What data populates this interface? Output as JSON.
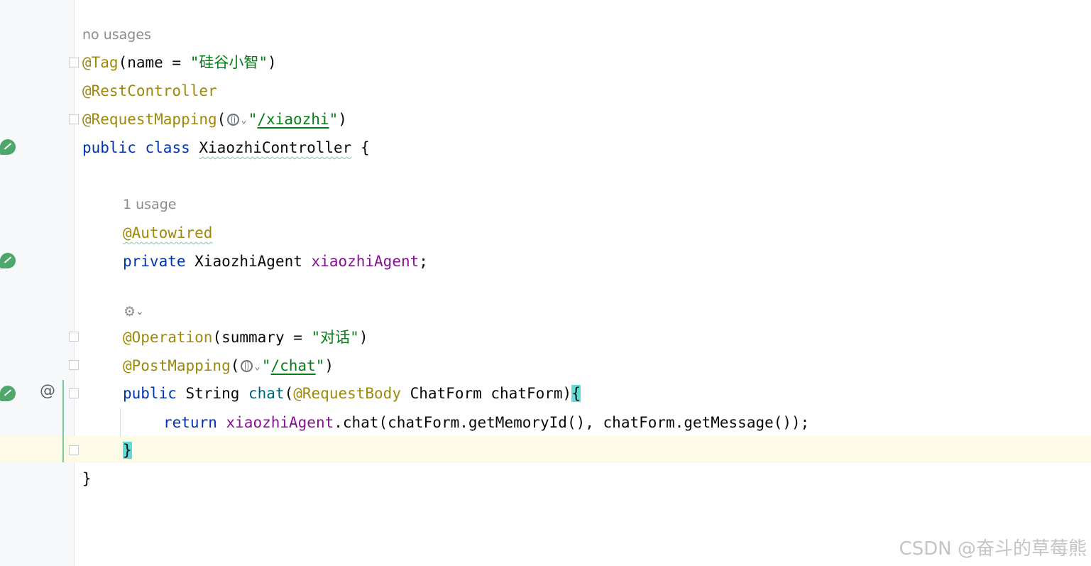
{
  "hints": {
    "class_usages": "no usages",
    "field_usages": "1 usage"
  },
  "code": {
    "l1": {
      "ann": "@Tag",
      "open": "(name = ",
      "str": "\"硅谷小智\"",
      "close": ")"
    },
    "l2": {
      "ann": "@RestController"
    },
    "l3": {
      "ann": "@RequestMapping",
      "open": "(",
      "q1": "\"",
      "path": "/xiaozhi",
      "q2": "\"",
      "close": ")"
    },
    "l4": {
      "kw1": "public",
      "kw2": "class",
      "name": "XiaozhiController",
      "brace": " {"
    },
    "l6": {
      "ann": "@Autowired"
    },
    "l7": {
      "kw": "private",
      "type": " XiaozhiAgent ",
      "field": "xiaozhiAgent",
      "semi": ";"
    },
    "l9": {
      "ann": "@Operation",
      "open": "(summary = ",
      "str": "\"对话\"",
      "close": ")"
    },
    "l10": {
      "ann": "@PostMapping",
      "open": "(",
      "q1": "\"",
      "path": "/chat",
      "q2": "\"",
      "close": ")"
    },
    "l11": {
      "kw": "public",
      "type": " String ",
      "meth": "chat",
      "open": "(",
      "ann": "@RequestBody",
      "params": " ChatForm chatForm)",
      "brace": "{"
    },
    "l12": {
      "kw": "return",
      "field": "xiaozhiAgent",
      "rest": ".chat(chatForm.getMemoryId(), chatForm.getMessage());"
    },
    "l13": {
      "brace": "}"
    },
    "l14": {
      "brace": "}"
    }
  },
  "icons": {
    "spring_bean": "spring-bean-icon",
    "web_endpoint": "globe-icon",
    "ai_assist": "ai-assistant-icon",
    "override": "at-sign-icon"
  },
  "watermark": "CSDN @奋斗的草莓熊",
  "colors": {
    "annotation": "#9e880d",
    "keyword": "#0033b3",
    "string": "#067d17",
    "field": "#871094",
    "method": "#00627a",
    "brace_highlight": "#5fdcd6",
    "current_line": "#fdfbe8"
  }
}
